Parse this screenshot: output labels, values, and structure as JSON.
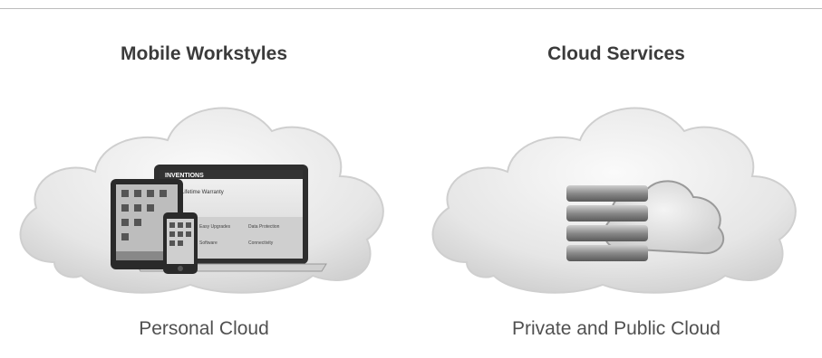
{
  "left_panel": {
    "heading": "Mobile Workstyles",
    "caption": "Personal Cloud",
    "laptop_brand": "INVENTIONS",
    "laptop_section": "Lifetime Warranty",
    "laptop_panels": [
      "Easy Upgrades",
      "Data Protection",
      "Connectivity",
      "Software"
    ]
  },
  "right_panel": {
    "heading": "Cloud Services",
    "caption": "Private and Public Cloud"
  },
  "colors": {
    "heading_text": "#3b3b3b",
    "caption_text": "#505050",
    "divider": "#bdbdbd"
  }
}
